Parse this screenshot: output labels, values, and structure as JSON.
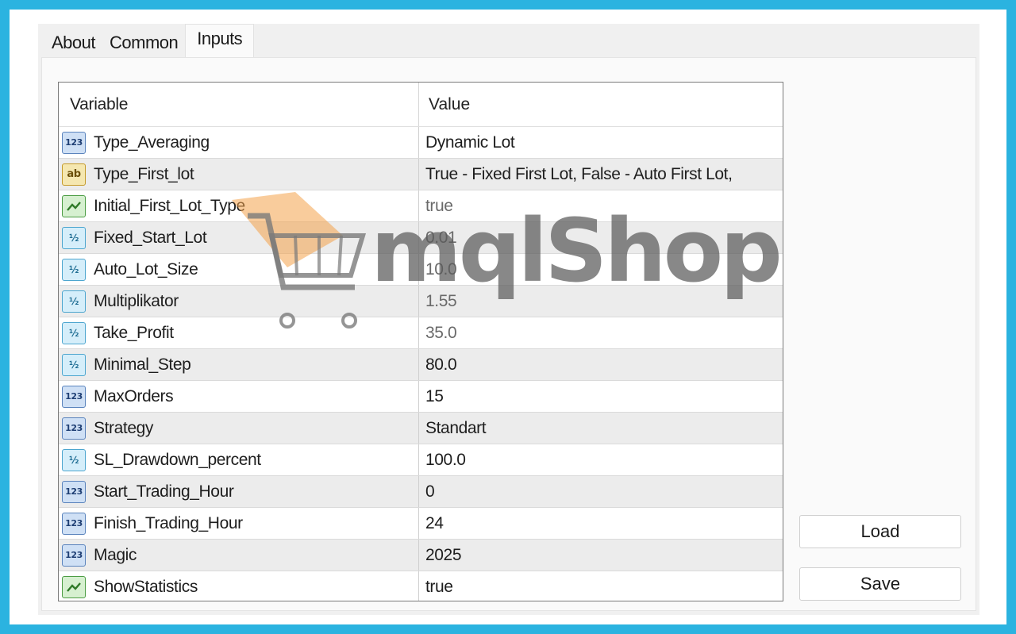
{
  "tabs": [
    "About",
    "Common",
    "Inputs"
  ],
  "active_tab": "Inputs",
  "grid": {
    "headers": {
      "variable": "Variable",
      "value": "Value"
    },
    "rows": [
      {
        "icon": "123",
        "type": "int",
        "variable": "Type_Averaging",
        "value": "Dynamic Lot"
      },
      {
        "icon": "ab",
        "type": "string",
        "variable": "Type_First_lot",
        "value": "True - Fixed First Lot, False - Auto First Lot,"
      },
      {
        "icon": "bool",
        "type": "bool",
        "variable": "Initial_First_Lot_Type",
        "value": "true"
      },
      {
        "icon": "½",
        "type": "double",
        "variable": "Fixed_Start_Lot",
        "value": "0.01"
      },
      {
        "icon": "½",
        "type": "double",
        "variable": "Auto_Lot_Size",
        "value": "10.0"
      },
      {
        "icon": "½",
        "type": "double",
        "variable": "Multiplikator",
        "value": "1.55"
      },
      {
        "icon": "½",
        "type": "double",
        "variable": "Take_Profit",
        "value": "35.0"
      },
      {
        "icon": "½",
        "type": "double",
        "variable": "Minimal_Step",
        "value": "80.0"
      },
      {
        "icon": "123",
        "type": "int",
        "variable": "MaxOrders",
        "value": "15"
      },
      {
        "icon": "123",
        "type": "int",
        "variable": "Strategy",
        "value": "Standart"
      },
      {
        "icon": "½",
        "type": "double",
        "variable": "SL_Drawdown_percent",
        "value": "100.0"
      },
      {
        "icon": "123",
        "type": "int",
        "variable": "Start_Trading_Hour",
        "value": "0"
      },
      {
        "icon": "123",
        "type": "int",
        "variable": "Finish_Trading_Hour",
        "value": "24"
      },
      {
        "icon": "123",
        "type": "int",
        "variable": "Magic",
        "value": "2025"
      },
      {
        "icon": "bool",
        "type": "bool",
        "variable": "ShowStatistics",
        "value": "true"
      }
    ]
  },
  "buttons": {
    "load": "Load",
    "save": "Save"
  },
  "watermark": {
    "text": "mqlShop",
    "icon": "shopping-cart-icon",
    "color": "#f4a24a"
  },
  "colors": {
    "outer_border": "#2bb3e0",
    "dialog_bg": "#f0f0f0",
    "row_alt": "#ececec"
  }
}
